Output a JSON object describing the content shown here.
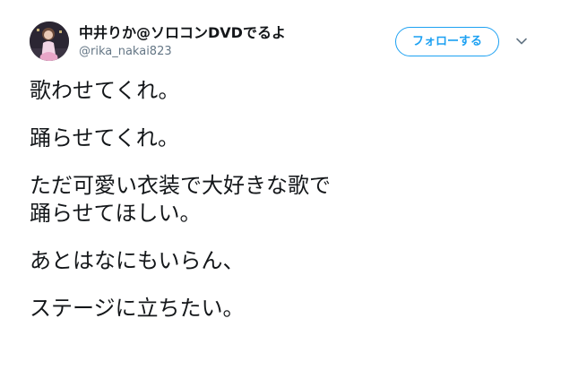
{
  "user": {
    "display_name": "中井りか@ソロコンDVDでるよ",
    "screen_name": "@rika_nakai823",
    "avatar_icon": "profile-photo"
  },
  "actions": {
    "follow_label": "フォローする",
    "menu_icon": "chevron-down-icon"
  },
  "colors": {
    "accent": "#1da1f2",
    "text": "#14171a",
    "muted": "#657786"
  },
  "tweet": {
    "paragraphs": [
      [
        "歌わせてくれ。"
      ],
      [
        "踊らせてくれ。"
      ],
      [
        "ただ可愛い衣装で大好きな歌で",
        "踊らせてほしい。"
      ],
      [
        "あとはなにもいらん、"
      ],
      [
        "ステージに立ちたい。"
      ]
    ]
  }
}
